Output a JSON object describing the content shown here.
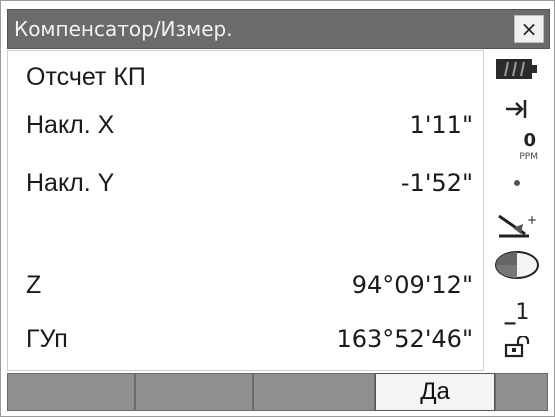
{
  "window": {
    "title": "Компенсатор/Измер.",
    "close_label": "×"
  },
  "measurements": [
    {
      "label": "Отсчет КП",
      "value": ""
    },
    {
      "label": "Накл. X",
      "value": "1'11\""
    },
    {
      "label": "Накл. Y",
      "value": "-1'52\""
    },
    {
      "label": "",
      "value": ""
    },
    {
      "label": "Z",
      "value": "94°09'12\""
    },
    {
      "label": "ГУп",
      "value": "163°52'46\""
    }
  ],
  "status": {
    "ppm_value": "0",
    "ppm_unit": "PPM",
    "level_value": "1",
    "icons": [
      "battery-icon",
      "target-icon",
      "ppm-icon",
      "dot-icon",
      "prism-icon",
      "tilt-circle-icon",
      "level-icon",
      "lock-icon"
    ]
  },
  "softkeys": [
    "",
    "",
    "",
    "Да",
    ""
  ],
  "colors": {
    "titlebar": "#6b6b6b",
    "softkey": "#8f8f8f",
    "softkey_active": "#f4f4f4"
  }
}
